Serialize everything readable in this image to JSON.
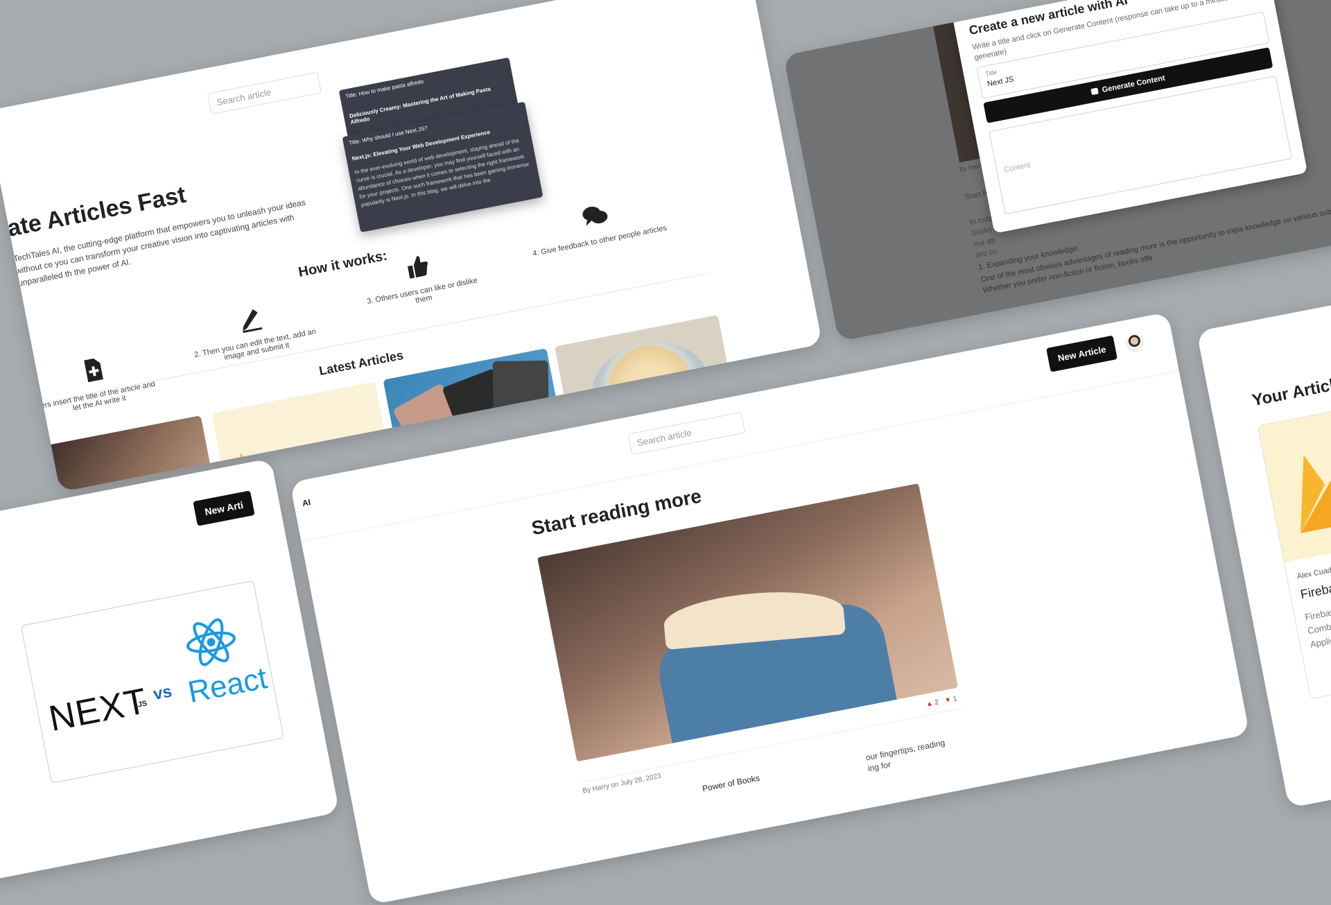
{
  "landing": {
    "search_placeholder": "Search article",
    "hero_title": "ate Articles Fast",
    "hero_text": "TechTales AI, the cutting-edge platform that empowers you to unleash your ideas without ce you can transform your creative vision into captivating articles with unparalleled th the power of AI.",
    "preview": {
      "title1": "Title: How to make pasta alfredo",
      "heading1": "Deliciously Creamy: Mastering the Art of Making Pasta Alfredo",
      "title2": "Title: Why should I use Next.JS?",
      "heading2": "Next.js: Elevating Your Web Development Experience",
      "body2": "In the ever-evolving world of web development, staying ahead of the curve is crucial. As a developer, you may find yourself faced with an abundance of choices when it comes to selecting the right framework for your projects. One such framework that has been gaining immense popularity is Next.js. In this blog, we will delve into the"
    },
    "how_title": "How it works:",
    "steps": [
      {
        "icon": "add-file-icon",
        "text": "ers insert the title of the article and let the AI write it"
      },
      {
        "icon": "pen-icon",
        "text": "2. Then you can edit the text, add an image and submit it"
      },
      {
        "icon": "thumbs-up-icon",
        "text": "3. Others users can like or dislike them"
      },
      {
        "icon": "chat-bubbles-icon",
        "text": "4. Give feedback to other people articles"
      }
    ],
    "latest_title": "Latest Articles"
  },
  "create": {
    "title": "Create a new article with AI",
    "hint": "Write a title and click on Generate Content (response can take up to a minute to generate)",
    "title_label": "Title",
    "title_value": "Next JS",
    "generate_label": "Generate Content",
    "content_placeholder": "Content",
    "bg_author": "By Harry",
    "bg_start": "Start R",
    "bg_in": "In toda books our att are co",
    "bg_para1": "1. Expanding your knowledge:",
    "bg_para2": "One of the most obvious advantages of reading more is the opportunity to expa knowledge on various subjects. Whether you prefer non-fiction or fiction, books offe"
  },
  "article": {
    "new_article_label": "New Article",
    "search_placeholder": "Search article",
    "title": "Start reading more",
    "likes": "2",
    "dislikes": "1",
    "meta": "By Harry on July 28, 2023",
    "sub_left": "Power of Books",
    "sub_right": "our fingertips, reading ing for"
  },
  "left_bottom": {
    "new_article_label": "New Arti",
    "next": "NEXT",
    "js": ".JS",
    "vs": "vs",
    "react": "React"
  },
  "article_logo_fragment": "AI",
  "your_articles": {
    "title": "Your Articles",
    "author": "Alex Cuadr",
    "card_title": "Firebas",
    "card_text1": "Firebase",
    "card_text2": "Combin",
    "card_text3": "Applica"
  },
  "colors": {
    "background": "#a6abaf",
    "dark": "#111111",
    "react_blue": "#1a9ae0",
    "firebase_yellow": "#f7b62c"
  }
}
